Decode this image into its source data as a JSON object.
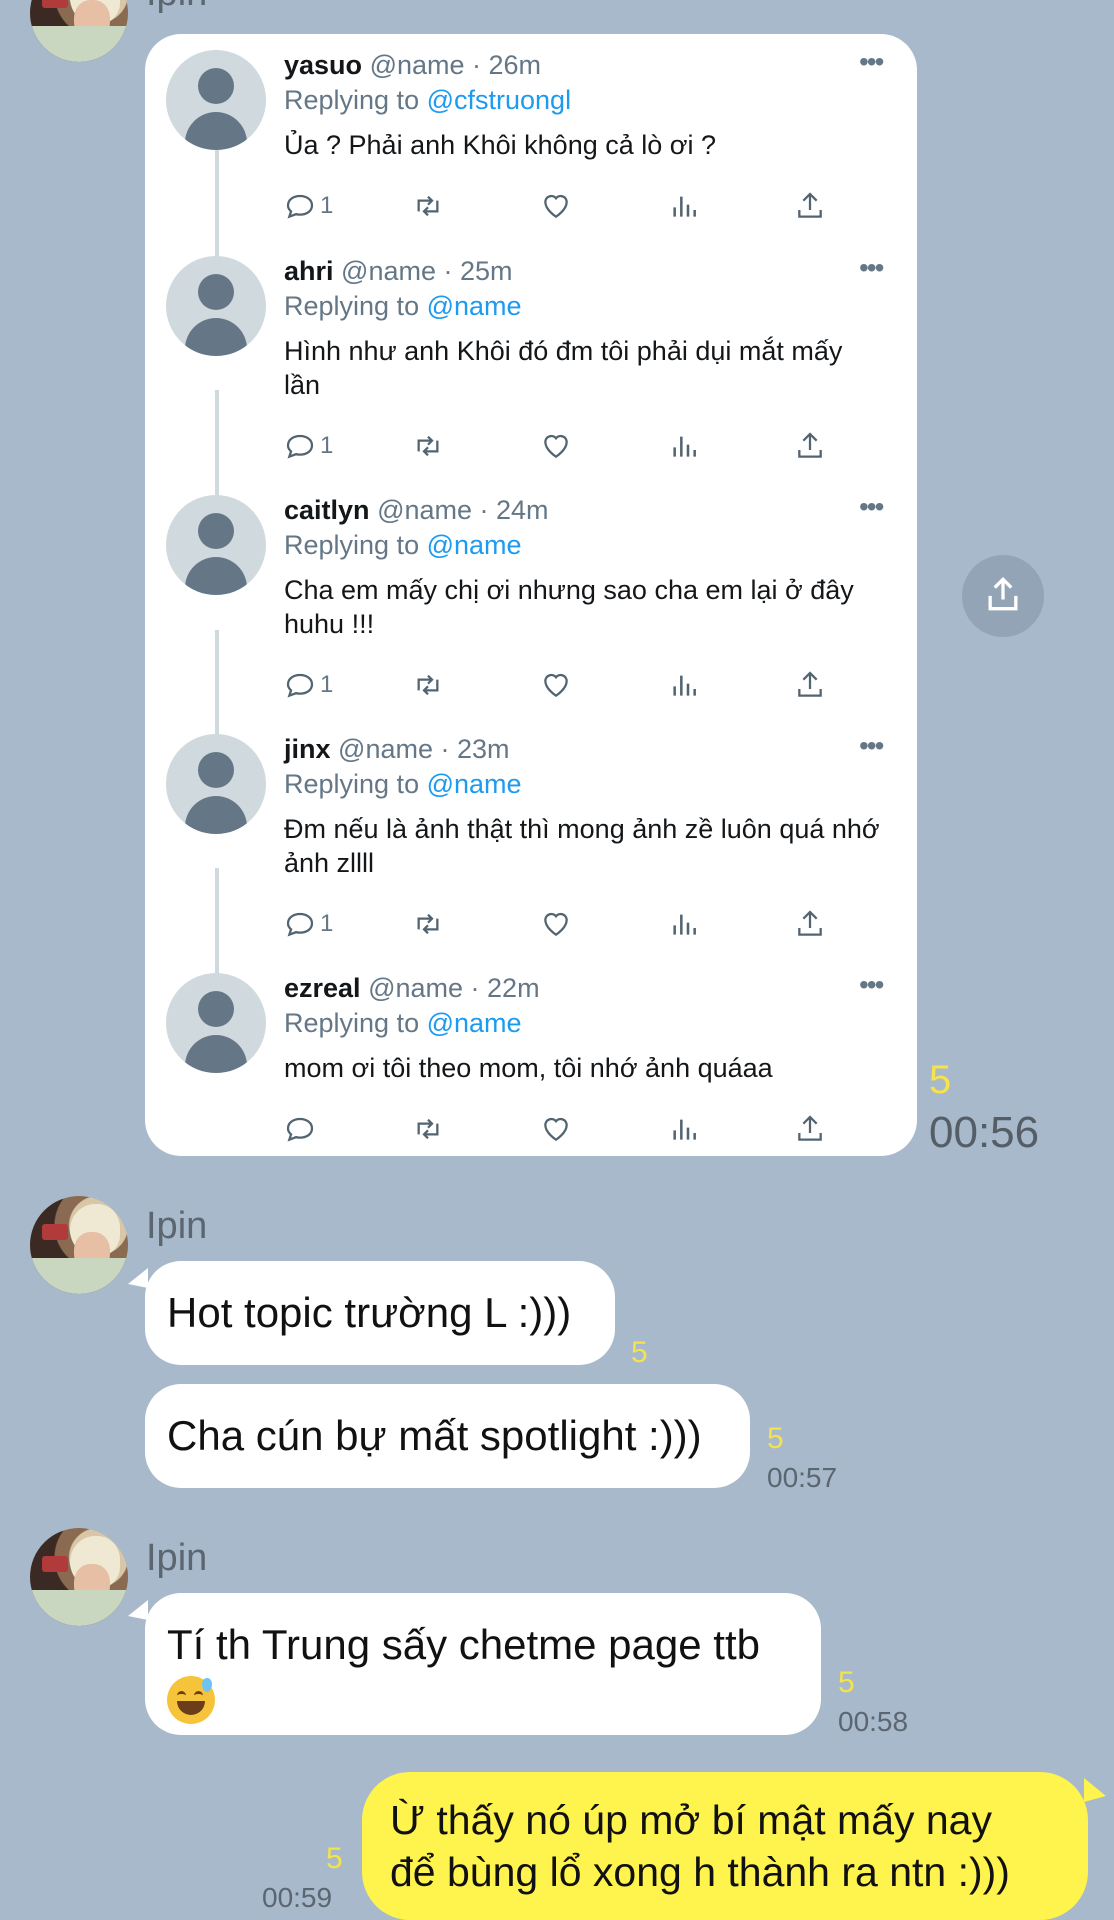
{
  "colors": {
    "chat_background": "#a7b9cb",
    "my_bubble": "#fff34d",
    "their_bubble": "#ffffff",
    "read_count": "#f4e34a",
    "twitter_link": "#1d9bf0"
  },
  "top_sender": {
    "name": "Ipin"
  },
  "tweet_card": {
    "tweets": [
      {
        "username": "yasuo",
        "handle": "@name",
        "time": "· 26m",
        "replying_label": "Replying to",
        "replying_to": "@cfstruongl",
        "text": "Ủa ? Phải anh Khôi không cả lò ơi ?",
        "reply_count": "1"
      },
      {
        "username": "ahri",
        "handle": "@name",
        "time": "· 25m",
        "replying_label": "Replying to",
        "replying_to": "@name",
        "text": "Hình như anh Khôi đó đm tôi phải dụi mắt mấy lần",
        "reply_count": "1"
      },
      {
        "username": "caitlyn",
        "handle": "@name",
        "time": "· 24m",
        "replying_label": "Replying to",
        "replying_to": "@name",
        "text": "Cha em mấy chị ơi nhưng sao cha em lại ở đây huhu !!!",
        "reply_count": "1"
      },
      {
        "username": "jinx",
        "handle": "@name",
        "time": "· 23m",
        "replying_label": "Replying to",
        "replying_to": "@name",
        "text": "Đm nếu là ảnh thật thì mong ảnh zề luôn quá nhớ ảnh zllll",
        "reply_count": "1"
      },
      {
        "username": "ezreal",
        "handle": "@name",
        "time": "· 22m",
        "replying_label": "Replying to",
        "replying_to": "@name",
        "text": "mom ơi tôi theo mom, tôi nhớ ảnh quáaa",
        "reply_count": ""
      }
    ],
    "more_icon_text": "•••",
    "read_count": "5",
    "time": "00:56"
  },
  "group1": {
    "sender_name": "Ipin",
    "messages": [
      {
        "text": "Hot topic trường L :)))",
        "read_count": "5"
      },
      {
        "text": "Cha cún bự mất spotlight :)))",
        "read_count": "5",
        "time": "00:57"
      }
    ]
  },
  "group2": {
    "sender_name": "Ipin",
    "message": {
      "text": "Tí th Trung sấy chetme page ttb",
      "emoji": "sweat-smile-emoji",
      "read_count": "5",
      "time": "00:58"
    }
  },
  "my_message": {
    "line1": "Ừ thấy nó úp mở bí mật mấy nay",
    "line2": "để bùng lổ xong h thành ra ntn :)))",
    "read_count": "5",
    "time": "00:59"
  },
  "icons": {
    "reply": "speech-bubble-icon",
    "retweet": "retweet-icon",
    "like": "heart-icon",
    "stats": "bar-chart-icon",
    "share": "share-upload-icon"
  }
}
